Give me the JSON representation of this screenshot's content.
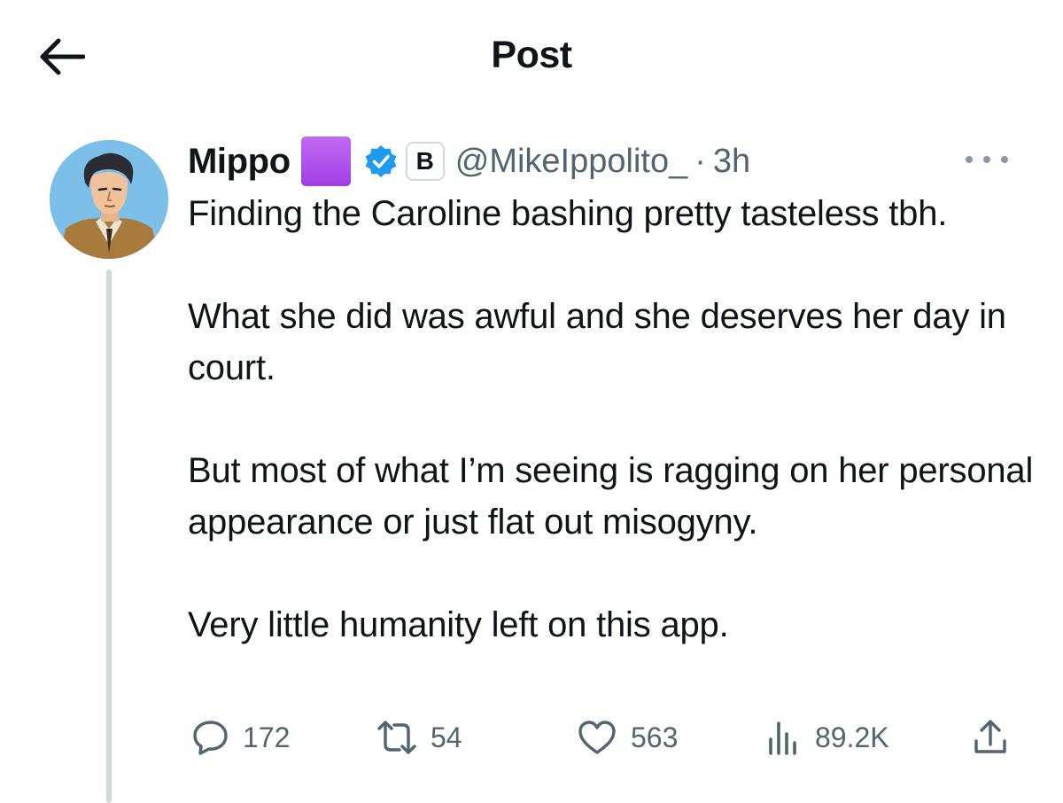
{
  "header": {
    "title": "Post",
    "back_icon": "arrow-left-icon"
  },
  "post": {
    "author": {
      "display_name": "Mippo",
      "handle": "@MikeIppolito_",
      "affiliate_badge_letter": "B",
      "name_emoji_color": "#a13ee6",
      "verified_color": "#1d9bf0"
    },
    "separator": "·",
    "time": "3h",
    "body": {
      "p1": "Finding the Caroline bashing pretty tasteless tbh.",
      "p2": "What she did was awful and she deserves her day in court.",
      "p3": "But most of what I’m seeing is ragging on her personal appearance or just flat out misogyny.",
      "p4": "Very little humanity left on this app."
    },
    "stats": {
      "replies": "172",
      "reposts": "54",
      "likes": "563",
      "views": "89.2K"
    }
  },
  "colors": {
    "text": "#0f1419",
    "secondary": "#536471",
    "thread_line": "#cfd9de",
    "avatar_bg": "#7cc0ea"
  }
}
